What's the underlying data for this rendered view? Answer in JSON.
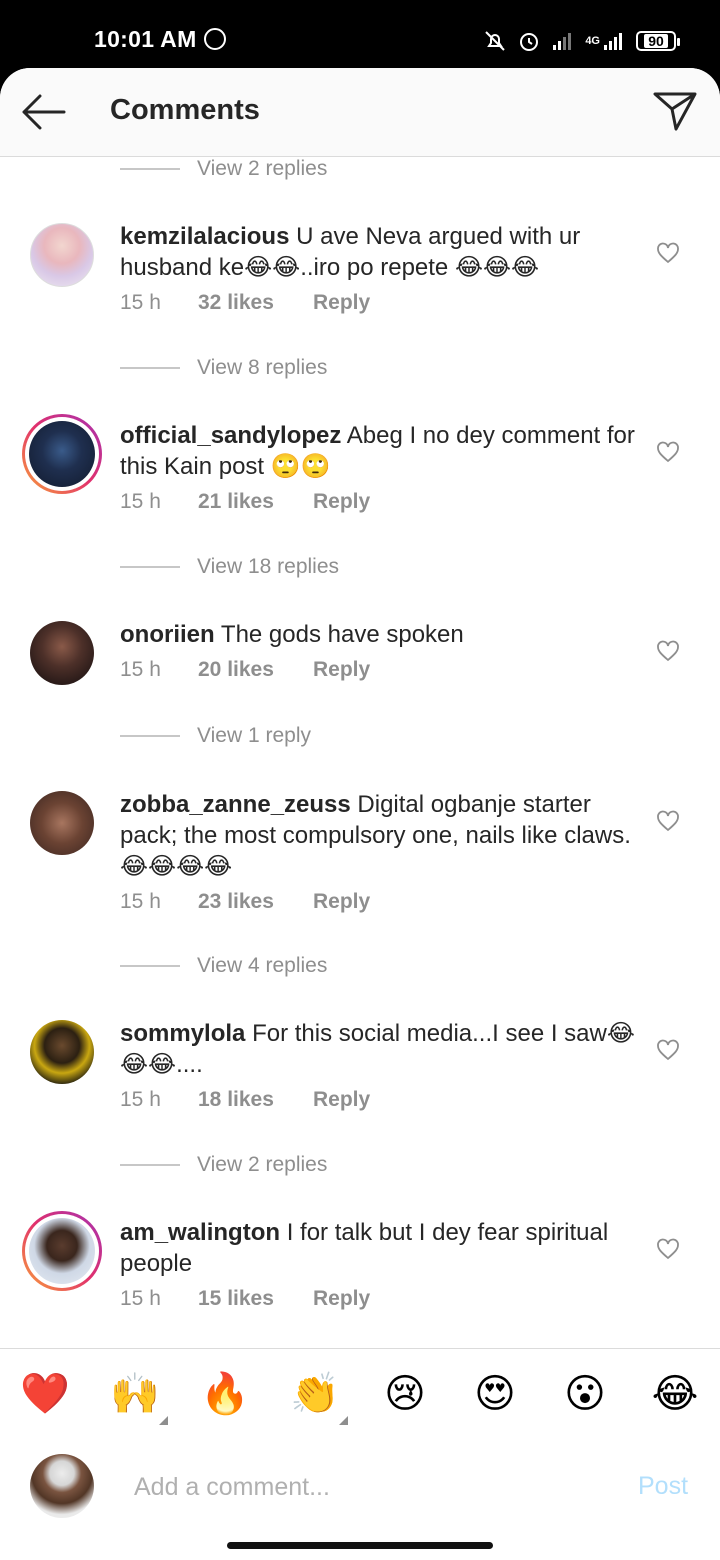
{
  "status_bar": {
    "time": "10:01 AM",
    "network": "4G",
    "battery": "90"
  },
  "header": {
    "title": "Comments"
  },
  "threads": [
    {
      "replies_label": "View 2 replies"
    },
    {
      "username": "kemzilalacious",
      "text": "U ave Neva argued with ur husband ke😂😂..iro po repete 😂😂😂",
      "time": "15 h",
      "likes": "32 likes",
      "reply": "Reply",
      "replies_label": "View 8 replies"
    },
    {
      "username": "official_sandylopez",
      "text": "Abeg I no dey comment for this Kain post 🙄🙄",
      "time": "15 h",
      "likes": "21 likes",
      "reply": "Reply",
      "replies_label": "View 18 replies"
    },
    {
      "username": "onoriien",
      "text": "The gods have spoken",
      "time": "15 h",
      "likes": "20 likes",
      "reply": "Reply",
      "replies_label": "View 1 reply"
    },
    {
      "username": "zobba_zanne_zeuss",
      "text": "Digital ogbanje starter pack; the most compulsory one, nails like claws. 😂😂😂😂",
      "time": "15 h",
      "likes": "23 likes",
      "reply": "Reply",
      "replies_label": "View 4 replies"
    },
    {
      "username": "sommylola",
      "text": "For this social media...I see I saw😂😂😂....",
      "time": "15 h",
      "likes": "18 likes",
      "reply": "Reply",
      "replies_label": "View 2 replies"
    },
    {
      "username": "am_walington",
      "text": "I for talk but I dey fear spiritual people",
      "time": "15 h",
      "likes": "15 likes",
      "reply": "Reply"
    }
  ],
  "emoji_bar": [
    "❤️",
    "🙌",
    "🔥",
    "👏",
    "😢",
    "😍",
    "😮",
    "😂"
  ],
  "composer": {
    "placeholder": "Add a comment...",
    "post_label": "Post"
  },
  "colors": {
    "accent_disabled": "#b2dffc",
    "meta_gray": "#8e8e8e",
    "text": "#262626"
  }
}
